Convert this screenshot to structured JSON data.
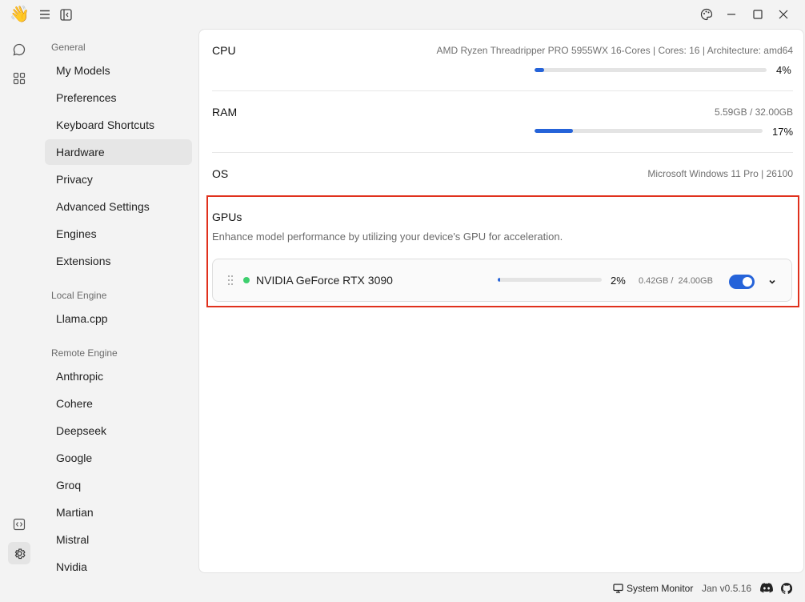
{
  "app": {
    "logo": "👋"
  },
  "sidebar": {
    "sections": [
      {
        "title": "General",
        "items": [
          "My Models",
          "Preferences",
          "Keyboard Shortcuts",
          "Hardware",
          "Privacy",
          "Advanced Settings",
          "Engines",
          "Extensions"
        ]
      },
      {
        "title": "Local Engine",
        "items": [
          "Llama.cpp"
        ]
      },
      {
        "title": "Remote Engine",
        "items": [
          "Anthropic",
          "Cohere",
          "Deepseek",
          "Google",
          "Groq",
          "Martian",
          "Mistral",
          "Nvidia"
        ]
      }
    ],
    "active_item": "Hardware"
  },
  "hardware": {
    "cpu": {
      "label": "CPU",
      "info": "AMD Ryzen Threadripper PRO 5955WX 16-Cores  |  Cores: 16  |  Architecture: amd64",
      "usage_percent": 4,
      "usage_text": "4%"
    },
    "ram": {
      "label": "RAM",
      "info": "5.59GB / 32.00GB",
      "usage_percent": 17,
      "usage_text": "17%"
    },
    "os": {
      "label": "OS",
      "info": "Microsoft Windows 11 Pro  |  26100"
    },
    "gpus": {
      "title": "GPUs",
      "description": "Enhance model performance by utilizing your device's GPU for acceleration.",
      "items": [
        {
          "name": "NVIDIA GeForce RTX 3090",
          "usage_percent": 2,
          "usage_text": "2%",
          "memory": "0.42GB /  24.00GB",
          "enabled": true,
          "status_color": "#3ecf6e"
        }
      ]
    }
  },
  "footer": {
    "system_monitor": "System Monitor",
    "version": "Jan v0.5.16"
  },
  "colors": {
    "accent": "#2563d9",
    "highlight_border": "#e0311d"
  }
}
